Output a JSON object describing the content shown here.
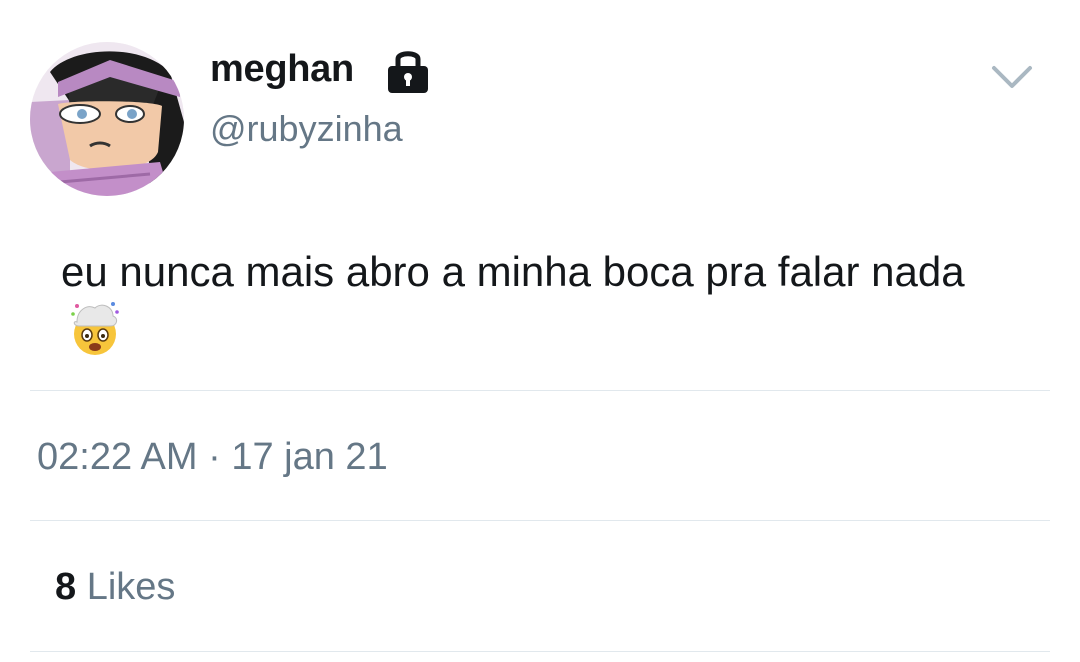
{
  "user": {
    "display_name": "meghan",
    "handle": "@rubyzinha",
    "protected_icon": "lock-icon",
    "avatar": "avatar"
  },
  "tweet": {
    "text": "eu nunca mais abro a minha boca pra falar nada",
    "emoji": "exploding-head-emoji",
    "time": "02:22 AM",
    "separator": "·",
    "date": "17 jan 21"
  },
  "stats": {
    "likes_count": "8",
    "likes_label": "Likes"
  },
  "menu": {
    "icon": "chevron-down-icon"
  },
  "colors": {
    "primary_text": "#14171a",
    "secondary_text": "#657786",
    "divider": "#e1e8ed"
  }
}
